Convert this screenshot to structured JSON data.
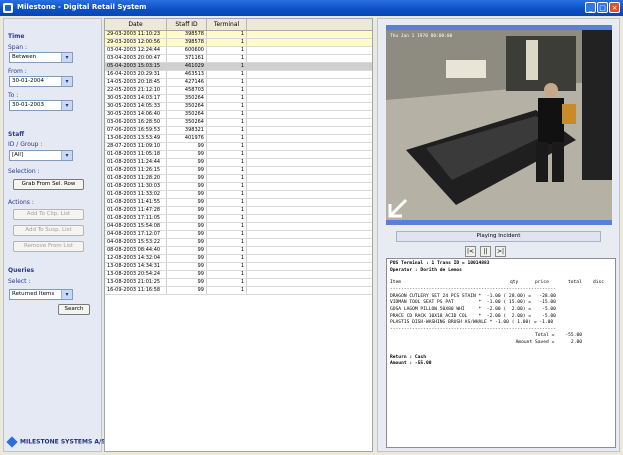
{
  "window": {
    "title": "Milestone - Digital Retail System"
  },
  "sidebar": {
    "time_label": "Time",
    "span_label": "Span :",
    "span_value": "Between",
    "from_label": "From :",
    "from_value": "30-01-2004",
    "to_label": "To :",
    "to_value": "30-01-2003",
    "staff_label": "Staff",
    "id_group_label": "ID / Group :",
    "id_group_value": "[All]",
    "selection_label": "Selection :",
    "grab_button": "Grab From Sel. Row",
    "actions_label": "Actions :",
    "add_clip_button": "Add To Clip. List",
    "add_susp_button": "Add To Susp. List",
    "remove_button": "Remove From List",
    "queries_label": "Queries",
    "select_label": "Select :",
    "select_value": "Returned Items",
    "search_button": "Search",
    "brand": "MILESTONE SYSTEMS A/S"
  },
  "table": {
    "columns": [
      "Date",
      "Staff ID",
      "Terminal"
    ],
    "rows": [
      [
        "29-03-2003 11:10:23",
        "398578",
        "1"
      ],
      [
        "29-03-2003 12:00:56",
        "398578",
        "1"
      ],
      [
        "03-04-2003 12:24:44",
        "600600",
        "1"
      ],
      [
        "03-04-2003 20:00:47",
        "371161",
        "1"
      ],
      [
        "05-04-2003 15:03:15",
        "461029",
        "1"
      ],
      [
        "16-04-2003 20:29:31",
        "463513",
        "1"
      ],
      [
        "14-05-2003 20:18:45",
        "427146",
        "1"
      ],
      [
        "22-05-2003 21:12:10",
        "458703",
        "1"
      ],
      [
        "30-05-2003 14:03:17",
        "350264",
        "1"
      ],
      [
        "30-05-2003 14:05:33",
        "350264",
        "1"
      ],
      [
        "30-05-2003 14:06:40",
        "350264",
        "1"
      ],
      [
        "03-06-2003 16:28:50",
        "350264",
        "1"
      ],
      [
        "07-06-2003 16:59:53",
        "398321",
        "1"
      ],
      [
        "13-06-2003 13:53:49",
        "401976",
        "1"
      ],
      [
        "28-07-2003 11:09:10",
        "99",
        "1"
      ],
      [
        "01-08-2003 11:05:18",
        "99",
        "1"
      ],
      [
        "01-08-2003 11:24:44",
        "99",
        "1"
      ],
      [
        "01-08-2003 11:26:15",
        "99",
        "1"
      ],
      [
        "01-08-2003 11:28:20",
        "99",
        "1"
      ],
      [
        "01-08-2003 11:30:03",
        "99",
        "1"
      ],
      [
        "01-08-2003 11:33:02",
        "99",
        "1"
      ],
      [
        "01-08-2003 11:41:55",
        "99",
        "1"
      ],
      [
        "01-08-2003 11:47:28",
        "99",
        "1"
      ],
      [
        "01-08-2003 17:11:05",
        "99",
        "1"
      ],
      [
        "04-08-2003 15:54:08",
        "99",
        "1"
      ],
      [
        "04-08-2003 17:12:07",
        "99",
        "1"
      ],
      [
        "04-08-2003 15:53:22",
        "99",
        "1"
      ],
      [
        "08-08-2003 08:44:40",
        "99",
        "1"
      ],
      [
        "12-08-2003 14:32:04",
        "99",
        "1"
      ],
      [
        "13-08-2003 14:34:31",
        "99",
        "1"
      ],
      [
        "13-08-2003 20:54:24",
        "99",
        "1"
      ],
      [
        "13-08-2003 21:01:25",
        "99",
        "1"
      ],
      [
        "16-09-2003 11:16:58",
        "99",
        "1"
      ]
    ]
  },
  "video": {
    "overlay": "Thu Jan 1 1970 00:00:00",
    "status": "Playing Incident",
    "prev_label": "|<",
    "pause_label": "||",
    "next_label": ">|"
  },
  "receipt": {
    "header1": "POS Terminal : 1 Trans ID = 10014883",
    "header2": "Operator : Dorith de Lemos",
    "col_item": "Item",
    "col_qty": "qty",
    "col_price": "price",
    "col_total": "total",
    "col_disc": "disc",
    "separator": "------------------------------------------------------------",
    "lines": [
      "DRAGON CUTLERY SET 24 PCS STAIN *  -1.00 ( 28.00) =   -28.00",
      "VIDMAN TOOL SEAT PS PAT         *  -1.00 ( 15.00) =   -15.00",
      "GOSA LAGOM PILLOW 50X80 WHI     *  -2.00 (  2.00) =    -5.00",
      "PRACE CD RACK 10X18 ACID COL    *  -2.00 (  2.00) =    -5.00",
      "PLASTIS DISH-WASHING BRUSH AS/WHALE * -1.00 ( 1.00) = -1.00"
    ],
    "total_line": "Total =    -55.00",
    "saved_line": "Amount Saved =      2.00",
    "return_line": "Return   : Cash",
    "amount_line": "Amount : -55.00"
  },
  "colors": {
    "titlebar": "#0b4ec4",
    "highlight_row": "#fdfbc6",
    "selected_row": "#cfcfcf",
    "panel_label": "#2b3a8a"
  }
}
